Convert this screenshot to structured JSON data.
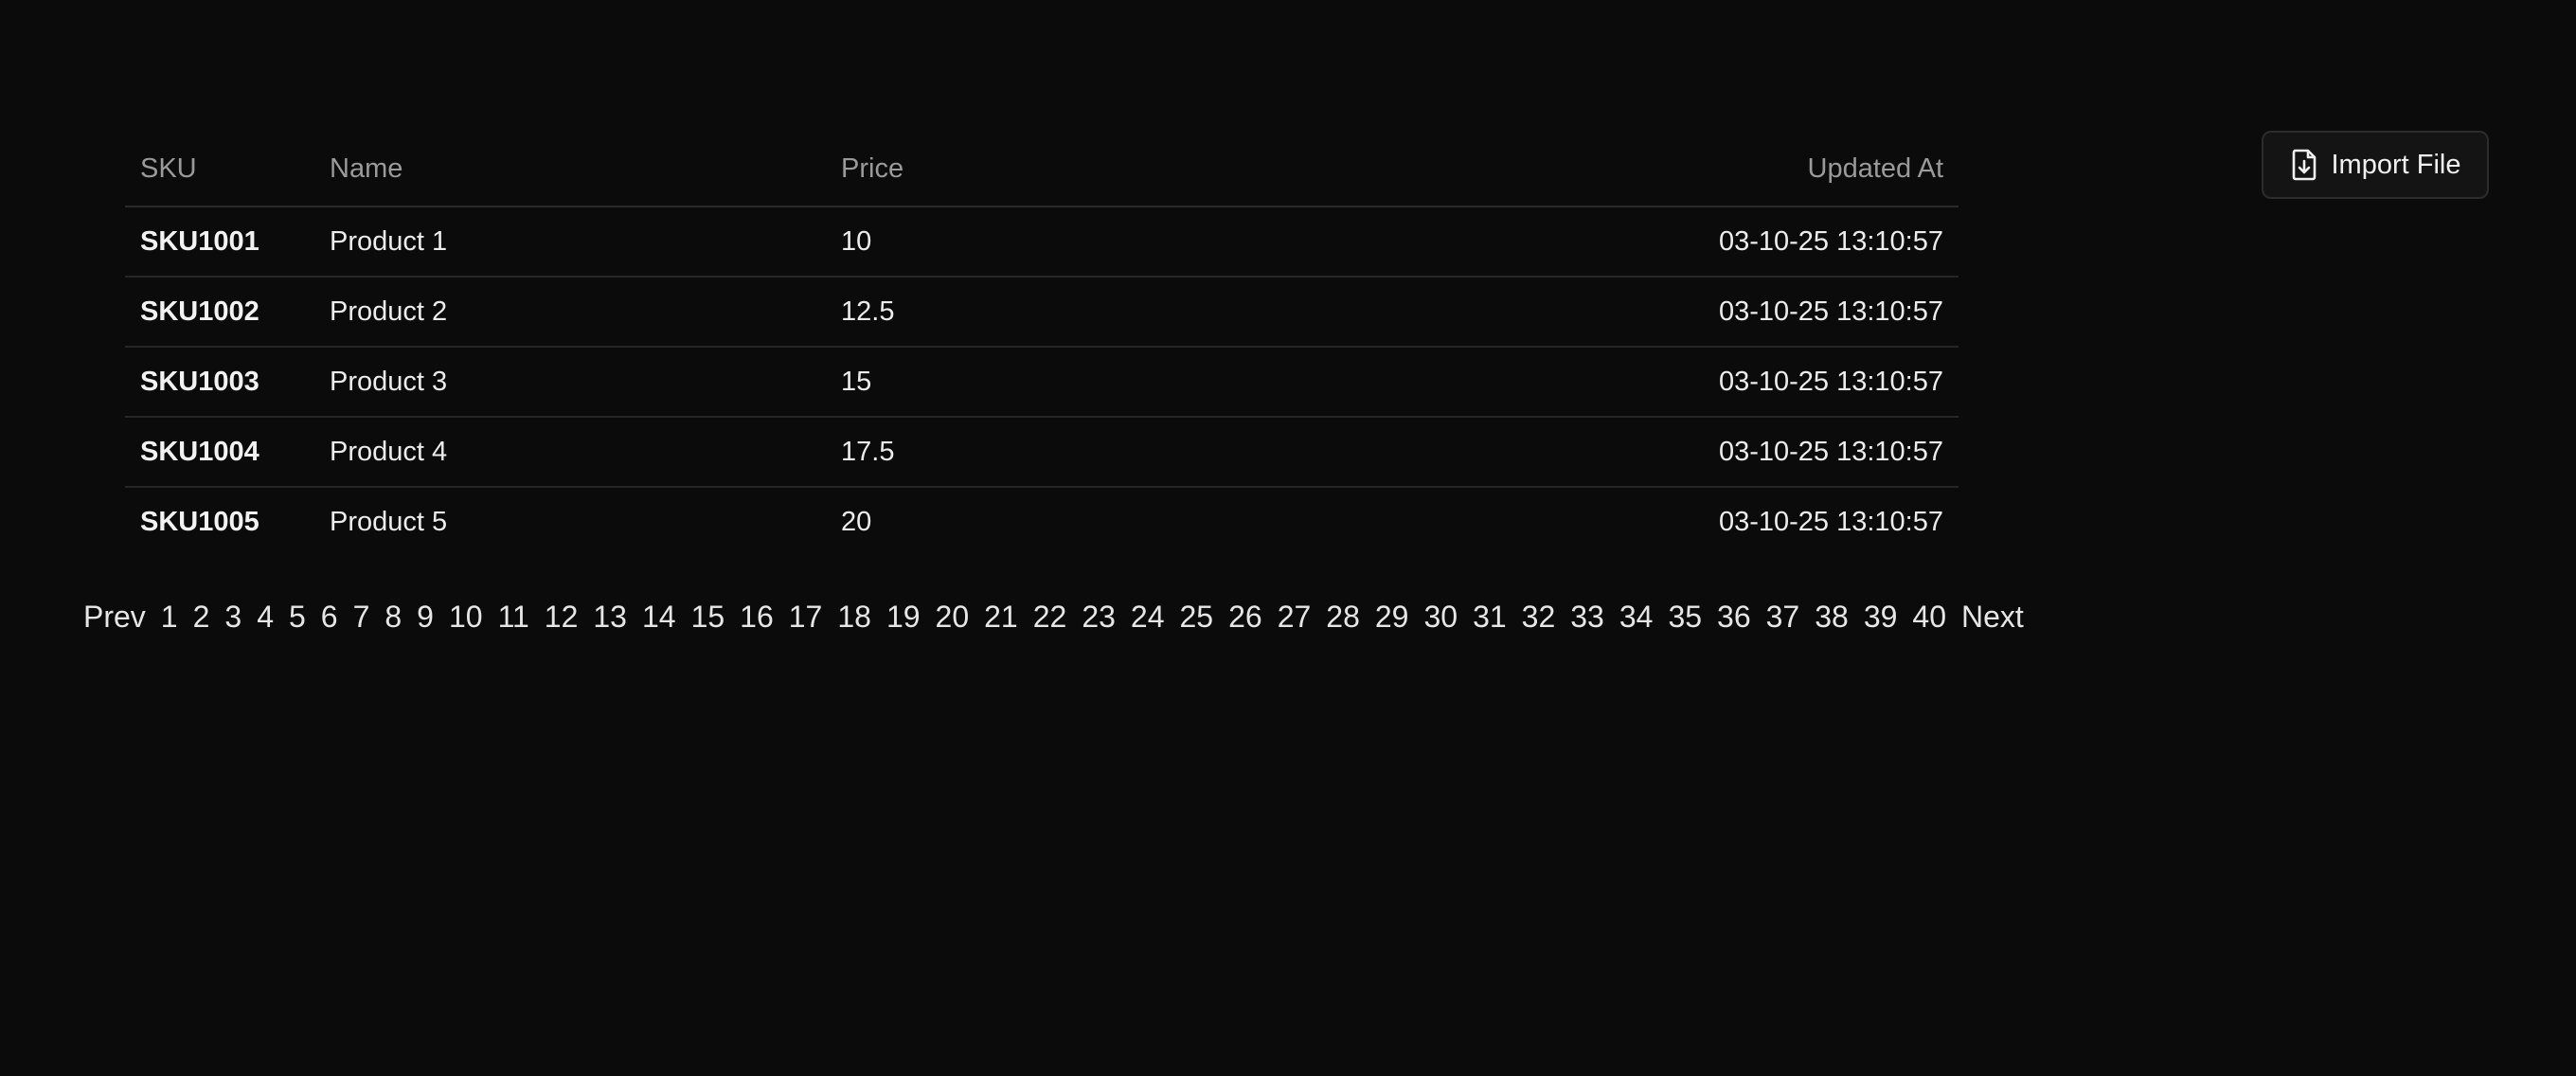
{
  "table": {
    "headers": {
      "sku": "SKU",
      "name": "Name",
      "price": "Price",
      "updated_at": "Updated At"
    },
    "rows": [
      {
        "sku": "SKU1001",
        "name": "Product 1",
        "price": "10",
        "updated_at": "03-10-25 13:10:57"
      },
      {
        "sku": "SKU1002",
        "name": "Product 2",
        "price": "12.5",
        "updated_at": "03-10-25 13:10:57"
      },
      {
        "sku": "SKU1003",
        "name": "Product 3",
        "price": "15",
        "updated_at": "03-10-25 13:10:57"
      },
      {
        "sku": "SKU1004",
        "name": "Product 4",
        "price": "17.5",
        "updated_at": "03-10-25 13:10:57"
      },
      {
        "sku": "SKU1005",
        "name": "Product 5",
        "price": "20",
        "updated_at": "03-10-25 13:10:57"
      }
    ]
  },
  "pagination": {
    "prev_label": "Prev",
    "next_label": "Next",
    "pages": [
      "1",
      "2",
      "3",
      "4",
      "5",
      "6",
      "7",
      "8",
      "9",
      "10",
      "11",
      "12",
      "13",
      "14",
      "15",
      "16",
      "17",
      "18",
      "19",
      "20",
      "21",
      "22",
      "23",
      "24",
      "25",
      "26",
      "27",
      "28",
      "29",
      "30",
      "31",
      "32",
      "33",
      "34",
      "35",
      "36",
      "37",
      "38",
      "39",
      "40"
    ]
  },
  "import_button": {
    "label": "Import File",
    "icon": "file-download-icon"
  },
  "colors": {
    "background": "#0b0b0b",
    "text": "#ededed",
    "muted": "#9a9a9a",
    "border": "#262626"
  }
}
